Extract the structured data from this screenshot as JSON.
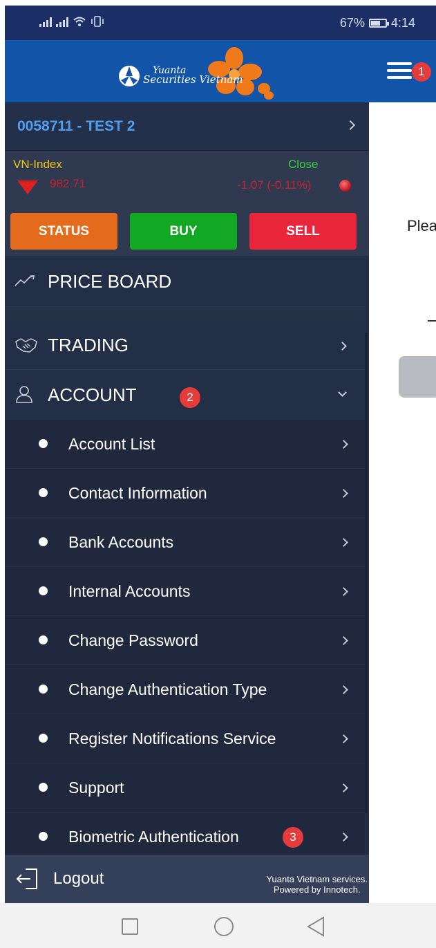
{
  "status_bar": {
    "battery": "67%",
    "battery_level": 0.67,
    "time": "4:14"
  },
  "brand": {
    "line1": "Yuanta",
    "line2": "Securities",
    "line3": "Vietnam"
  },
  "account": {
    "label": "0058711 - TEST 2"
  },
  "index": {
    "name": "VN-Index",
    "status": "Close",
    "value": "982.71",
    "change": "-1.07 (-0.11%)"
  },
  "actions": {
    "status": "STATUS",
    "buy": "BUY",
    "sell": "SELL"
  },
  "menu": {
    "price_board": "PRICE BOARD",
    "trading": "TRADING",
    "account": "ACCOUNT"
  },
  "account_submenu": [
    {
      "label": "Account List"
    },
    {
      "label": "Contact Information"
    },
    {
      "label": "Bank Accounts"
    },
    {
      "label": "Internal Accounts"
    },
    {
      "label": "Change Password"
    },
    {
      "label": "Change Authentication Type"
    },
    {
      "label": "Register Notifications Service"
    },
    {
      "label": "Support"
    },
    {
      "label": "Biometric Authentication"
    }
  ],
  "badges": {
    "menu": "1",
    "account": "2",
    "biometric": "3"
  },
  "logout": {
    "label": "Logout",
    "footer_line1": "Yuanta Vietnam services.",
    "footer_line2": "Powered by Innotech."
  },
  "main_peek": {
    "text": "Plea"
  },
  "colors": {
    "header_blue": "#1254a8",
    "drawer_bg": "#232f47",
    "status_orange": "#e36b1b",
    "buy_green": "#12a824",
    "sell_red": "#e8253a",
    "account_link": "#4f9ff1",
    "index_yellow": "#f0c419",
    "close_green": "#35d13a",
    "down_red": "#c8202a",
    "badge_red": "#e43b3b"
  }
}
